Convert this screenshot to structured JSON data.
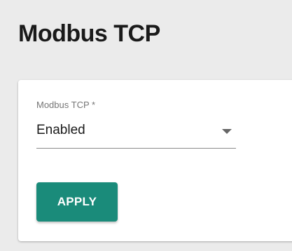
{
  "page": {
    "title": "Modbus TCP"
  },
  "form": {
    "modbus_select": {
      "label": "Modbus TCP *",
      "value": "Enabled"
    },
    "apply_label": "APPLY"
  },
  "colors": {
    "background": "#ebebeb",
    "card": "#ffffff",
    "accent": "#1a8b7a",
    "label": "#757575",
    "text": "#1a1a1a"
  },
  "icons": {
    "select_arrow": "chevron-down-icon"
  }
}
